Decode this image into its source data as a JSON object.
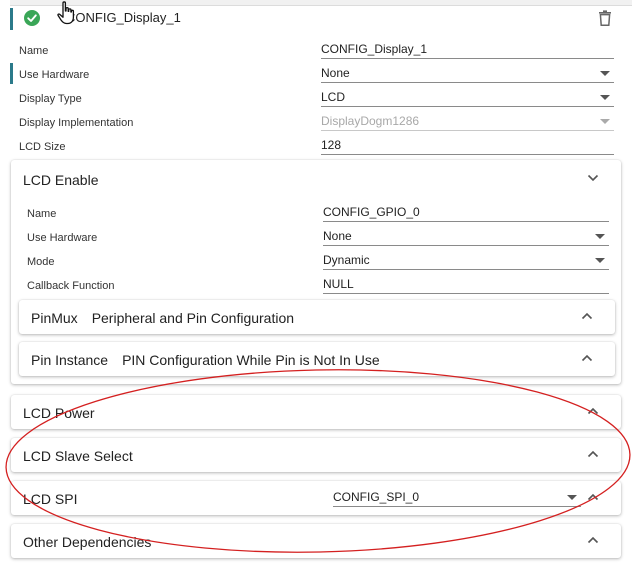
{
  "header": {
    "title": "CONFIG_Display_1",
    "accent_color": "#2b7a8a",
    "check_color": "#3aa657"
  },
  "display_fields": [
    {
      "label": "Name",
      "value": "CONFIG_Display_1",
      "type": "text"
    },
    {
      "label": "Use Hardware",
      "value": "None",
      "type": "select"
    },
    {
      "label": "Display Type",
      "value": "LCD",
      "type": "select"
    },
    {
      "label": "Display Implementation",
      "value": "DisplayDogm1286",
      "type": "select",
      "disabled": true
    },
    {
      "label": "LCD Size",
      "value": "128",
      "type": "text"
    }
  ],
  "lcd_enable": {
    "title": "LCD Enable",
    "fields": [
      {
        "label": "Name",
        "value": "CONFIG_GPIO_0",
        "type": "text"
      },
      {
        "label": "Use Hardware",
        "value": "None",
        "type": "select"
      },
      {
        "label": "Mode",
        "value": "Dynamic",
        "type": "select"
      },
      {
        "label": "Callback Function",
        "value": "NULL",
        "type": "text"
      }
    ],
    "subsections": [
      {
        "title": "PinMux",
        "subtitle": "Peripheral and Pin Configuration"
      },
      {
        "title": "Pin Instance",
        "subtitle": "PIN Configuration While Pin is Not In Use"
      }
    ]
  },
  "sections": [
    {
      "title": "LCD Power"
    },
    {
      "title": "LCD Slave Select"
    },
    {
      "title": "LCD SPI",
      "value": "CONFIG_SPI_0"
    },
    {
      "title": "Other Dependencies"
    }
  ],
  "annotation_color": "#d42020"
}
